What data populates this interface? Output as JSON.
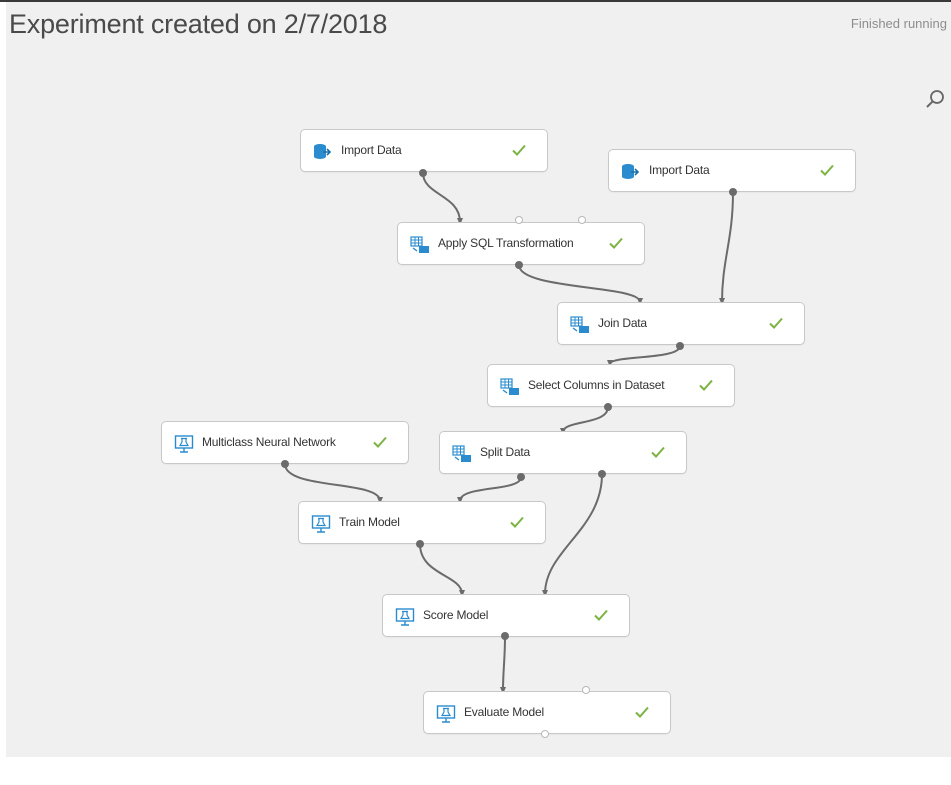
{
  "experiment": {
    "title": "Experiment created on 2/7/2018",
    "status": "Finished running"
  },
  "toolbar": {
    "search_icon": "search-icon"
  },
  "colors": {
    "check": "#7cb342",
    "icon_blue": "#1e88c8",
    "connector": "#6b6b6b"
  },
  "modules": [
    {
      "label": "Import Data",
      "icon": "import-data-icon",
      "status": "check"
    },
    {
      "label": "Import Data",
      "icon": "import-data-icon",
      "status": "check"
    },
    {
      "label": "Apply SQL Transformation",
      "icon": "data-transform-icon",
      "status": "check"
    },
    {
      "label": "Join Data",
      "icon": "data-transform-icon",
      "status": "check"
    },
    {
      "label": "Select Columns in Dataset",
      "icon": "data-transform-icon",
      "status": "check"
    },
    {
      "label": "Multiclass Neural Network",
      "icon": "ml-module-icon",
      "status": "check"
    },
    {
      "label": "Split Data",
      "icon": "data-transform-icon",
      "status": "check"
    },
    {
      "label": "Train Model",
      "icon": "ml-module-icon",
      "status": "check"
    },
    {
      "label": "Score Model",
      "icon": "ml-module-icon",
      "status": "check"
    },
    {
      "label": "Evaluate Model",
      "icon": "ml-module-icon",
      "status": "check"
    }
  ]
}
